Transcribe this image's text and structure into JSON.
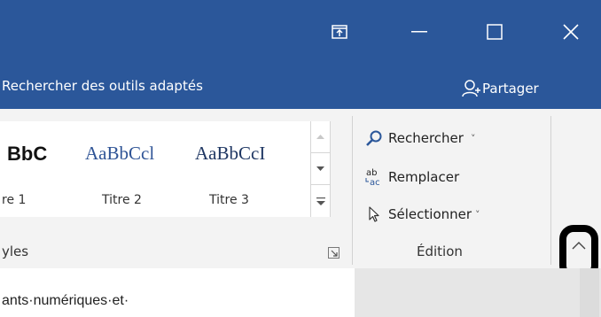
{
  "titlebar": {
    "controls": [
      "ribbon-display-options",
      "minimize",
      "maximize",
      "close"
    ]
  },
  "tellme": {
    "text": "Rechercher des outils adaptés",
    "share_label": "Partager"
  },
  "styles_group": {
    "samples": [
      {
        "preview": "BbC",
        "label": "re 1"
      },
      {
        "preview": "AaBbCcl",
        "label": "Titre 2"
      },
      {
        "preview": "AaBbCcI",
        "label": "Titre 3"
      }
    ],
    "group_label": "yles"
  },
  "editing_group": {
    "find_label": "Rechercher",
    "replace_label": "Remplacer",
    "replace_icon_text": "ab\nac",
    "select_label": "Sélectionner",
    "group_label": "Édition"
  },
  "document": {
    "visible_text": "ants·numériques·et·"
  },
  "colors": {
    "brand_blue": "#2b579a",
    "ribbon_bg": "#f3f3f3",
    "heading_blue": "#2f5496"
  },
  "icons": [
    "ribbon-display-options-icon",
    "minimize-icon",
    "maximize-icon",
    "close-icon",
    "share-person-icon",
    "search-icon",
    "replace-icon",
    "select-cursor-icon",
    "chevron-up-icon"
  ]
}
